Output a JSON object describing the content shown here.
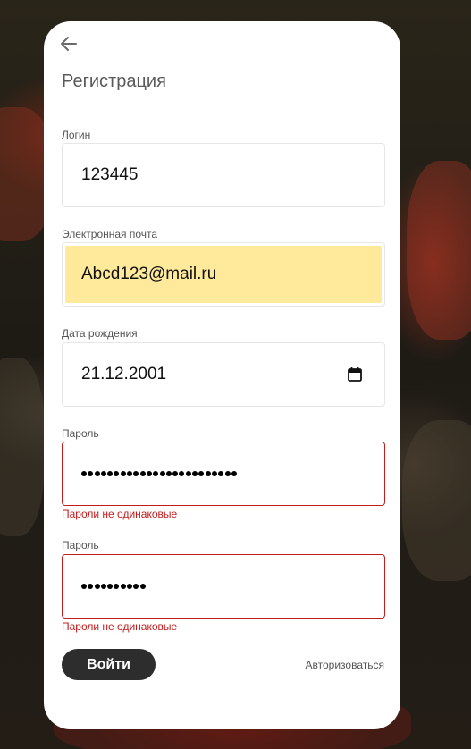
{
  "form": {
    "title": "Регистрация",
    "fields": {
      "login": {
        "label": "Логин",
        "value": "123445"
      },
      "email": {
        "label": "Электронная почта",
        "value": "Abcd123@mail.ru",
        "autofill_color": "#ffe99a"
      },
      "birthdate": {
        "label": "Дата рождения",
        "value": "21.12.2001",
        "icon": "calendar-icon"
      },
      "password": {
        "label": "Пароль",
        "masked_length": 24,
        "error": "Пароли не одинаковые"
      },
      "password_confirm": {
        "label": "Пароль",
        "masked_length": 10,
        "error": "Пароли не одинаковые"
      }
    },
    "submit_label": "Войти",
    "auth_link_label": "Авторизоваться",
    "back_icon": "arrow-left-icon"
  },
  "colors": {
    "error": "#c21c1c",
    "button_bg": "#2d2d2d",
    "card_bg": "#ffffff"
  }
}
